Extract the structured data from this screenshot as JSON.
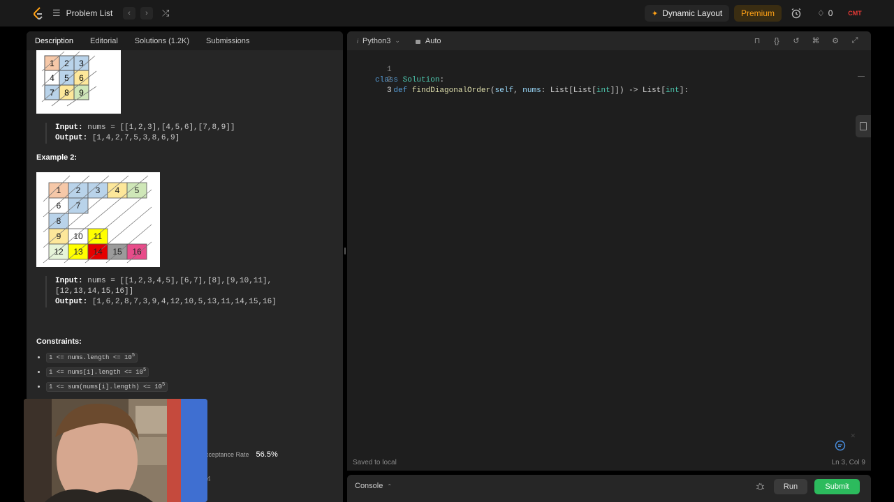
{
  "topbar": {
    "title": "Problem List",
    "dynamic_layout": "Dynamic Layout",
    "premium": "Premium",
    "streak_count": "0",
    "avatar_text": "CMT",
    "colors": {
      "premium_bg": "#3a2d12",
      "premium_text": "#ffa116",
      "avatar": "#e53935"
    }
  },
  "left": {
    "tabs": [
      {
        "label": "Description"
      },
      {
        "label": "Editorial"
      },
      {
        "label": "Solutions (1.2K)"
      },
      {
        "label": "Submissions"
      }
    ],
    "example1": {
      "grid": [
        "1",
        "2",
        "3",
        "4",
        "5",
        "6",
        "7",
        "8",
        "9"
      ],
      "input_label": "Input:",
      "input_value": "nums = [[1,2,3],[4,5,6],[7,8,9]]",
      "output_label": "Output:",
      "output_value": "[1,4,2,7,5,3,8,6,9]"
    },
    "example2": {
      "heading": "Example 2:",
      "grid_labels": [
        "1",
        "2",
        "3",
        "4",
        "5",
        "6",
        "7",
        "8",
        "9",
        "10",
        "11",
        "12",
        "13",
        "14",
        "15",
        "16"
      ],
      "input_label": "Input:",
      "input_value_line1": "nums = [[1,2,3,4,5],[6,7],[8],[9,10,11],",
      "input_value_line2": "[12,13,14,15,16]]",
      "output_label": "Output:",
      "output_value": "[1,6,2,8,7,3,9,4,12,10,5,13,11,14,15,16]"
    },
    "constraints": {
      "heading": "Constraints:",
      "items": [
        {
          "text": "1 <= nums.length <= 10",
          "sup": "5"
        },
        {
          "text": "1 <= nums[i].length <= 10",
          "sup": "5"
        },
        {
          "text": "1 <= sum(nums[i].length) <= 10",
          "sup": "5"
        }
      ]
    },
    "acceptance_label": "Acceptance Rate",
    "acceptance_value": "56.5%",
    "partial_text": "4"
  },
  "editor": {
    "language": "Python3",
    "auto": "Auto",
    "lines": [
      "1",
      "2",
      "3"
    ],
    "status": "Saved to local",
    "cursor": "Ln 3, Col 9"
  },
  "console": {
    "label": "Console",
    "run": "Run",
    "submit": "Submit",
    "colors": {
      "submit_bg": "#2cbb5d"
    }
  }
}
